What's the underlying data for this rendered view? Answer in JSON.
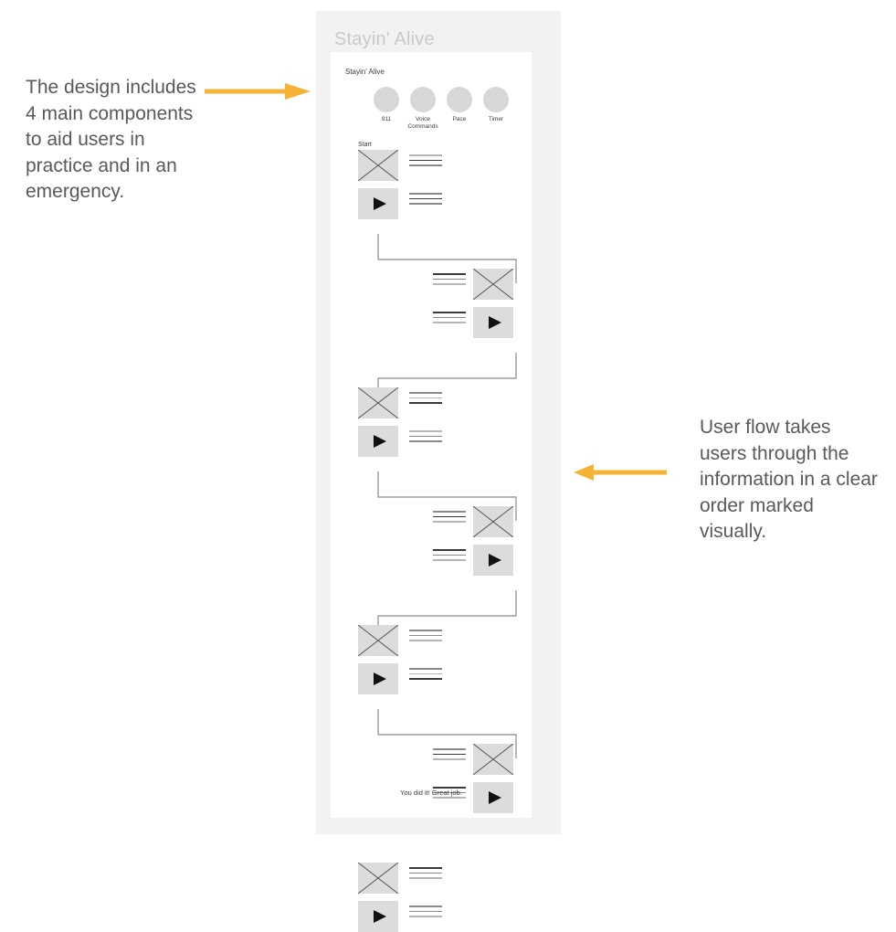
{
  "annotations": {
    "left": {
      "text": "The design includes 4 main components to aid users in practice and in an emergency.",
      "arrow_direction": "right",
      "arrow_color": "#f5b335"
    },
    "right": {
      "text": "User flow takes users through the information in a clear order marked visually.",
      "arrow_direction": "left",
      "arrow_color": "#f5b335"
    }
  },
  "device": {
    "app_title": "Stayin' Alive",
    "frame_color": "#f2f2f2",
    "screen_color": "#ffffff",
    "title_color": "#c9c9c9"
  },
  "screen": {
    "title": "Stayin' Alive",
    "components": [
      {
        "label": "911",
        "icon": "circle-icon"
      },
      {
        "label": "Voice Commands",
        "icon": "circle-icon"
      },
      {
        "label": "Pace",
        "icon": "circle-icon"
      },
      {
        "label": "Timer",
        "icon": "circle-icon"
      }
    ],
    "start_label": "Start",
    "end_message": "You did it! Great job.",
    "tile_color": "#dcdcdc",
    "connector_color": "#8a8a8a"
  },
  "flow": {
    "steps": [
      {
        "index": 1,
        "align": "left",
        "image_icon": "image-placeholder-icon",
        "media_icon": "play-icon"
      },
      {
        "index": 2,
        "align": "right",
        "image_icon": "image-placeholder-icon",
        "media_icon": "play-icon"
      },
      {
        "index": 3,
        "align": "left",
        "image_icon": "image-placeholder-icon",
        "media_icon": "play-icon"
      },
      {
        "index": 4,
        "align": "right",
        "image_icon": "image-placeholder-icon",
        "media_icon": "play-icon"
      },
      {
        "index": 5,
        "align": "left",
        "image_icon": "image-placeholder-icon",
        "media_icon": "play-icon"
      },
      {
        "index": 6,
        "align": "right",
        "image_icon": "image-placeholder-icon",
        "media_icon": "play-icon"
      },
      {
        "index": 7,
        "align": "left",
        "image_icon": "image-placeholder-icon",
        "media_icon": "play-icon"
      }
    ]
  }
}
